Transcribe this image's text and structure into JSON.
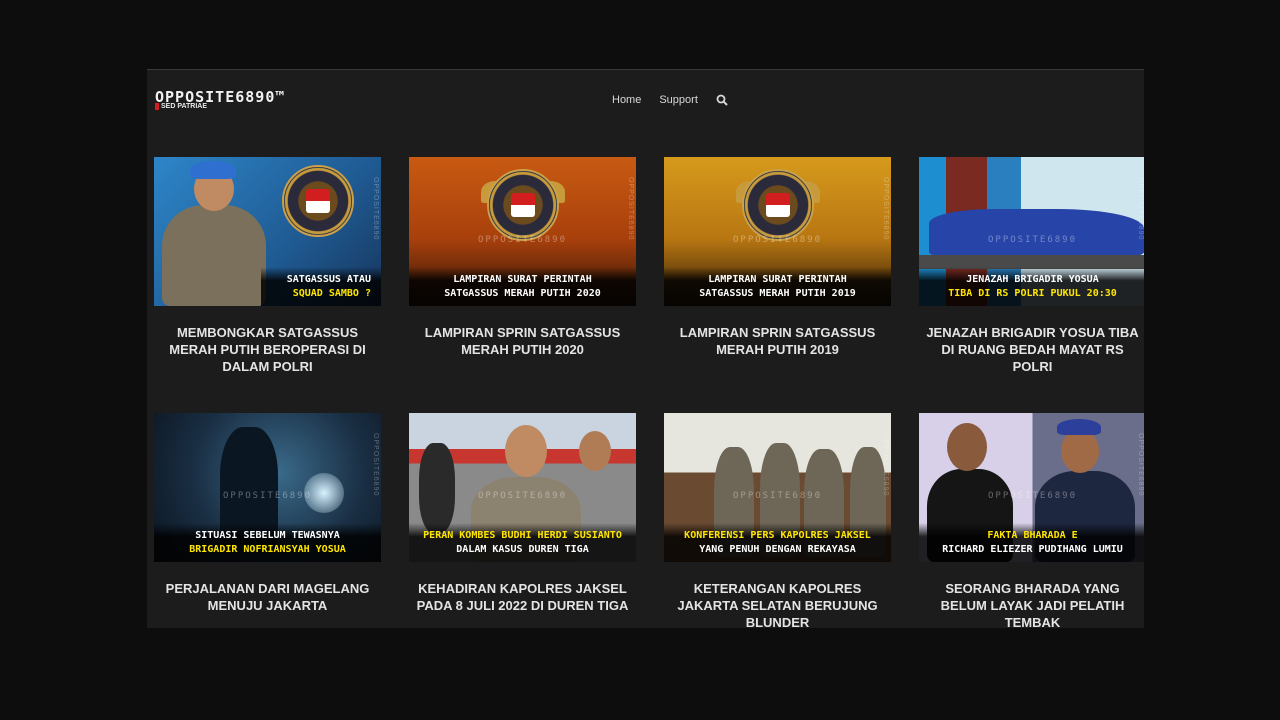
{
  "site": {
    "logo": "OPPOSITE6890™",
    "tagline_red": "",
    "tagline_white": "SED PATRIAE"
  },
  "nav": {
    "items": [
      "Home",
      "Support"
    ]
  },
  "posts": [
    {
      "caption_l1": "SATGASSUS ATAU",
      "caption_l2": "SQUAD SAMBO ?",
      "title": "MEMBONGKAR SATGASSUS MERAH PUTIH BEROPERASI DI DALAM POLRI"
    },
    {
      "caption_l1": "LAMPIRAN SURAT PERINTAH",
      "caption_l2": "SATGASSUS MERAH PUTIH 2020",
      "title": "LAMPIRAN SPRIN SATGASSUS MERAH PUTIH 2020"
    },
    {
      "caption_l1": "LAMPIRAN SURAT PERINTAH",
      "caption_l2": "SATGASSUS MERAH PUTIH 2019",
      "title": "LAMPIRAN SPRIN SATGASSUS MERAH PUTIH 2019"
    },
    {
      "caption_l1": "JENAZAH BRIGADIR YOSUA",
      "caption_l2": "TIBA DI RS POLRI PUKUL 20:30",
      "title": "JENAZAH BRIGADIR YOSUA TIBA DI RUANG BEDAH MAYAT RS POLRI"
    },
    {
      "caption_l1": "SITUASI SEBELUM TEWASNYA",
      "caption_l2": "BRIGADIR NOFRIANSYAH YOSUA",
      "title": "PERJALANAN DARI MAGELANG MENUJU JAKARTA"
    },
    {
      "caption_l1": "PERAN KOMBES BUDHI HERDI SUSIANTO",
      "caption_l2": "DALAM KASUS DUREN TIGA",
      "title": "KEHADIRAN KAPOLRES JAKSEL PADA 8 JULI 2022 DI DUREN TIGA"
    },
    {
      "caption_l1": "KONFERENSI PERS KAPOLRES JAKSEL",
      "caption_l2": "YANG PENUH DENGAN REKAYASA",
      "title": "KETERANGAN KAPOLRES JAKARTA SELATAN BERUJUNG BLUNDER"
    },
    {
      "caption_l1": "FAKTA BHARADA E",
      "caption_l2": "RICHARD ELIEZER PUDIHANG LUMIU",
      "title": "SEORANG BHARADA YANG BELUM LAYAK JADI PELATIH TEMBAK"
    }
  ],
  "colors": {
    "page_bg": "#0d0d0d",
    "site_bg": "#1c1c1c",
    "caption_yellow": "#ffe600",
    "tagline_red": "#d21e1e"
  },
  "icons": {
    "search": "search-icon"
  }
}
